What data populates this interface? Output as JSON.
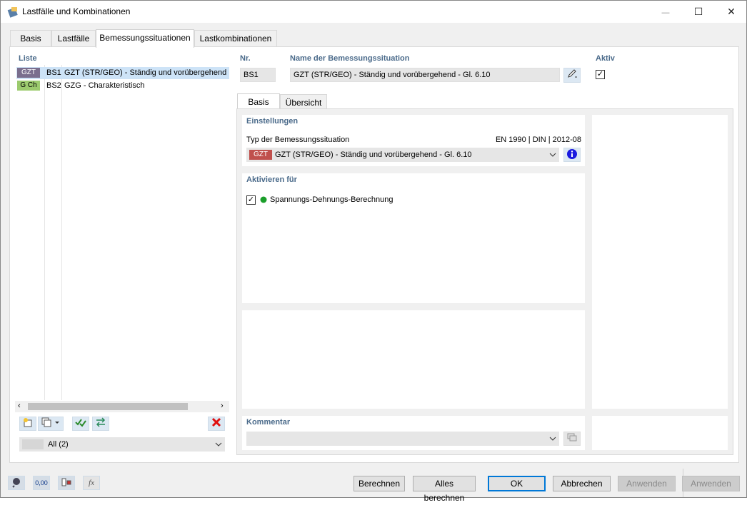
{
  "window": {
    "title": "Lastfälle und Kombinationen",
    "minimize": "—",
    "maximize": "☐",
    "close": "✕"
  },
  "main_tabs": [
    {
      "label": "Basis"
    },
    {
      "label": "Lastfälle"
    },
    {
      "label": "Bemessungssituationen"
    },
    {
      "label": "Lastkombinationen"
    }
  ],
  "list": {
    "title": "Liste",
    "items": [
      {
        "badge": "GZT",
        "badge_bg": "#7a6e8e",
        "id": "BS1",
        "text": "GZT (STR/GEO) - Ständig und vorübergehend"
      },
      {
        "badge": "G Ch",
        "badge_bg": "#9ccb6e",
        "id": "BS2",
        "text": "GZG - Charakteristisch"
      }
    ],
    "filter_value": "All (2)"
  },
  "nr": {
    "label": "Nr.",
    "value": "BS1"
  },
  "name": {
    "label": "Name der Bemessungssituation",
    "value": "GZT (STR/GEO) - Ständig und vorübergehend - Gl. 6.10"
  },
  "aktiv": {
    "label": "Aktiv",
    "checked": "✓"
  },
  "sub_tabs": [
    {
      "label": "Basis"
    },
    {
      "label": "Übersicht"
    }
  ],
  "einstellungen": {
    "title": "Einstellungen",
    "type_label": "Typ der Bemessungssituation",
    "norm": "EN 1990 | DIN | 2012-08",
    "type_badge": "GZT",
    "type_badge_color": "#c0504d",
    "type_value": "GZT (STR/GEO) - Ständig und vorübergehend - Gl. 6.10"
  },
  "aktivieren": {
    "title": "Aktivieren für",
    "item_label": "Spannungs-Dehnungs-Berechnung",
    "checked": "✓",
    "dot_color": "#1a9e2a"
  },
  "kommentar": {
    "title": "Kommentar"
  },
  "buttons": {
    "berechnen": "Berechnen",
    "alles_berechnen": "Alles berechnen",
    "ok": "OK",
    "abbrechen": "Abbrechen",
    "anwenden1": "Anwenden",
    "anwenden2": "Anwenden"
  },
  "bottom_icons": {
    "value_icon": "0,00",
    "fx_icon": "fx"
  }
}
